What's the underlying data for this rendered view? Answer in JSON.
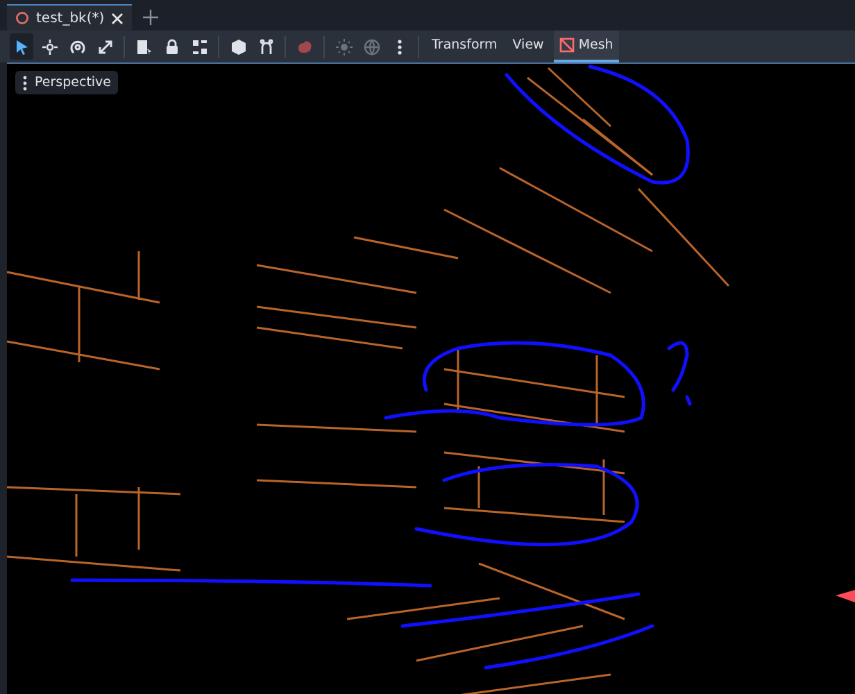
{
  "scene_tab": {
    "title": "test_bk(*)",
    "selected": true
  },
  "toolbar": {
    "tools": [
      {
        "selected": true,
        "disabled": false
      },
      {
        "selected": false,
        "disabled": false
      },
      {
        "selected": false,
        "disabled": false
      },
      {
        "selected": false,
        "disabled": false
      },
      {
        "selected": false,
        "disabled": false
      },
      {
        "selected": false,
        "disabled": false
      },
      {
        "selected": false,
        "disabled": false
      },
      {
        "selected": false,
        "disabled": false
      },
      {
        "selected": false,
        "disabled": false
      },
      {
        "selected": false,
        "disabled": true
      },
      {
        "selected": false,
        "disabled": true
      },
      {
        "selected": false,
        "disabled": true
      },
      {
        "selected": false,
        "disabled": false
      }
    ],
    "menus": [
      {
        "label": "Transform",
        "selected": false
      },
      {
        "label": "View",
        "selected": false
      },
      {
        "label": "Mesh",
        "selected": true
      }
    ]
  },
  "viewport": {
    "view_mode": "Perspective"
  }
}
